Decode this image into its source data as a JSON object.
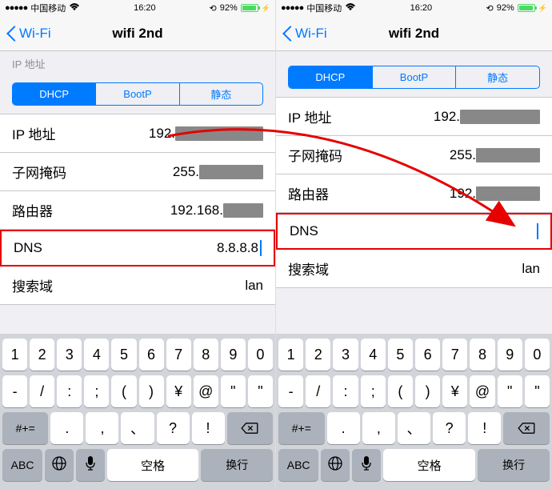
{
  "status": {
    "carrier": "中国移动",
    "time": "16:20",
    "battery": "92%"
  },
  "nav": {
    "back": "Wi-Fi",
    "title": "wifi 2nd"
  },
  "section_header": "IP 地址",
  "tabs": {
    "dhcp": "DHCP",
    "bootp": "BootP",
    "static": "静态"
  },
  "left": {
    "rows": {
      "ip": {
        "label": "IP 地址",
        "value_visible": "192."
      },
      "subnet": {
        "label": "子网掩码",
        "value_visible": "255."
      },
      "router": {
        "label": "路由器",
        "value_visible": "192.168."
      },
      "dns": {
        "label": "DNS",
        "value": "8.8.8.8"
      },
      "search": {
        "label": "搜索域",
        "value": "lan"
      }
    }
  },
  "right": {
    "rows": {
      "ip": {
        "label": "IP 地址",
        "value_visible": "192."
      },
      "subnet": {
        "label": "子网掩码",
        "value_visible": "255."
      },
      "router": {
        "label": "路由器",
        "value_visible": "192."
      },
      "dns": {
        "label": "DNS",
        "value": ""
      },
      "search": {
        "label": "搜索域",
        "value": "lan"
      }
    }
  },
  "keyboard": {
    "row1": [
      "1",
      "2",
      "3",
      "4",
      "5",
      "6",
      "7",
      "8",
      "9",
      "0"
    ],
    "row2": [
      "-",
      "/",
      ":",
      ";",
      "(",
      ")",
      "¥",
      "@",
      "\"",
      "\""
    ],
    "row3_left": "#+=",
    "row3": [
      ".",
      ",",
      "、",
      "?",
      "!"
    ],
    "row4": {
      "abc": "ABC",
      "space": "空格",
      "enter": "换行"
    }
  },
  "annotation": {
    "arrow_means": "Clear DNS field (from 8.8.8.8 to empty)"
  }
}
